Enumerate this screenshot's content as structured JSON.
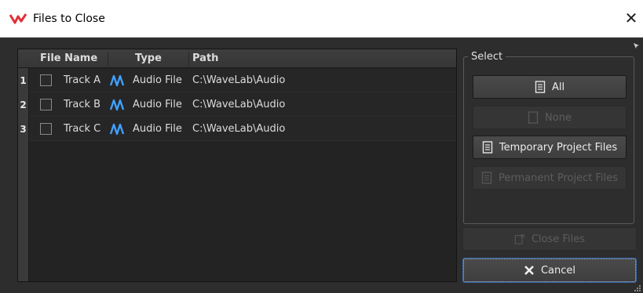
{
  "window": {
    "title": "Files to Close",
    "close_glyph": "✕"
  },
  "table": {
    "columns": [
      "File Name",
      "Type",
      "Path"
    ],
    "rows": [
      {
        "num": "1",
        "file_name": "Track A",
        "type": "Audio File",
        "type_icon": "audio-wave-icon",
        "path": "C:\\WaveLab\\Audio",
        "checked": false
      },
      {
        "num": "2",
        "file_name": "Track B",
        "type": "Audio File",
        "type_icon": "audio-wave-icon",
        "path": "C:\\WaveLab\\Audio",
        "checked": false
      },
      {
        "num": "3",
        "file_name": "Track C",
        "type": "Audio File",
        "type_icon": "audio-wave-icon",
        "path": "C:\\WaveLab\\Audio",
        "checked": false
      }
    ]
  },
  "select_group": {
    "label": "Select",
    "all_label": "All",
    "none_label": "None",
    "temporary_label": "Temporary Project Files",
    "permanent_label": "Permanent Project Files"
  },
  "actions": {
    "close_files_label": "Close Files",
    "cancel_label": "Cancel"
  },
  "colors": {
    "accent_wave": "#3fa0ff",
    "app_icon": "#e0303a",
    "focus_border": "#3c6aa8"
  }
}
